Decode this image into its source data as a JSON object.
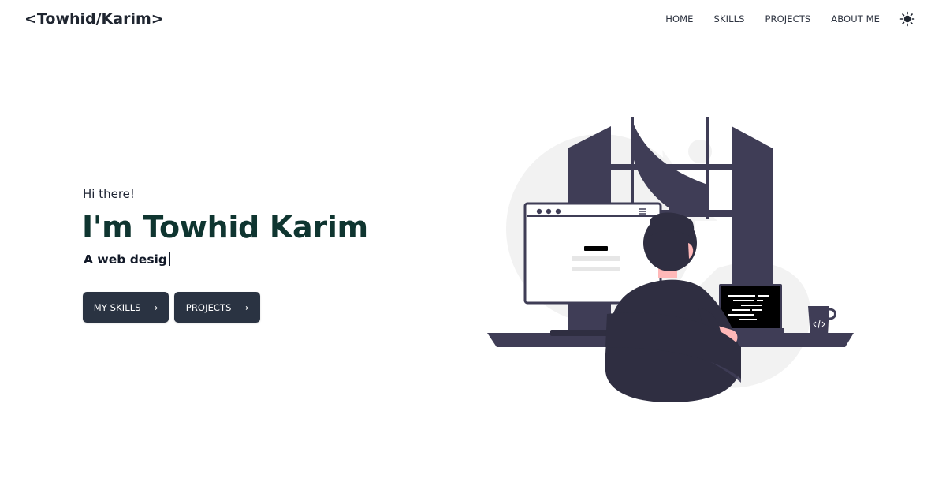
{
  "header": {
    "logo": "<Towhid/Karim>",
    "nav": [
      {
        "label": "HOME"
      },
      {
        "label": "SKILLS"
      },
      {
        "label": "PROJECTS"
      },
      {
        "label": "ABOUT ME"
      }
    ],
    "theme_toggle_icon": "sun-icon"
  },
  "hero": {
    "greeting": "Hi there!",
    "name": "I'm Towhid Karim",
    "tagline": "A web desig",
    "buttons": {
      "skills_label": "MY SKILLS",
      "projects_label": "PROJECTS",
      "arrow": "⟶"
    }
  },
  "colors": {
    "name_color": "#0f3530",
    "button_bg": "#2a3342",
    "illustration_dark": "#3f3d56",
    "illustration_light": "#f2f2f2",
    "skin": "#ffb8b8"
  }
}
